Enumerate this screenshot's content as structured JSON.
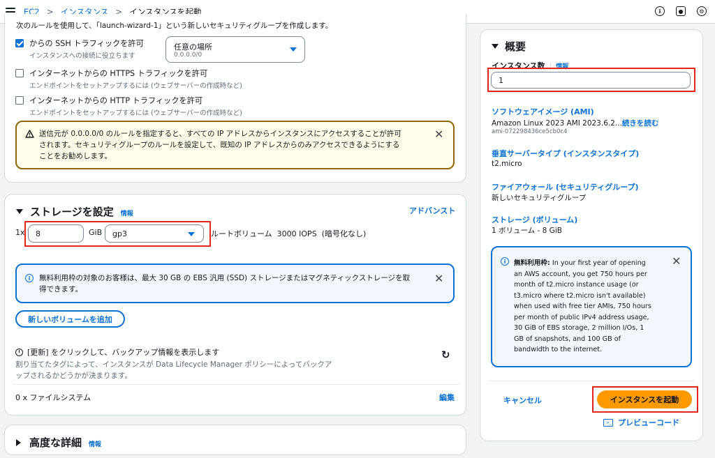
{
  "breadcrumb": {
    "ec2": "EC2",
    "instances": "インスタンス",
    "current": "インスタンスを起動"
  },
  "header_icons": [
    "info-icon",
    "notifications-icon",
    "settings-icon"
  ],
  "network": {
    "top_text": "次のルールを使用して、「launch-wizard-1」という新しいセキュリティグループを作成します。",
    "ssh_label": "からの SSH トラフィックを許可",
    "ssh_sub": "インスタンスへの接続に役立ちます",
    "ssh_checked": true,
    "source_select_label": "任意の場所",
    "source_select_value": "0.0.0.0/0",
    "https_label": "インターネットからの HTTPS トラフィックを許可",
    "https_sub": "エンドポイントをセットアップするには (ウェブサーバーの作成時など)",
    "http_label": "インターネットからの HTTP トラフィックを許可",
    "http_sub": "エンドポイントをセットアップするには (ウェブサーバーの作成時など)",
    "warning_line1": "送信元が 0.0.0.0/0 のルールを指定すると、すべての IP アドレスからインスタンスにアクセスすることが許可",
    "warning_line2": "されます。セキュリティグループのルールを設定して、既知の IP アドレスからのみアクセスできるようにする",
    "warning_line3": "ことをお勧めします。"
  },
  "storage": {
    "title": "ストレージを設定",
    "info": "情報",
    "advanced": "アドバンスト",
    "count_prefix": "1x",
    "size_value": "8",
    "unit": "GiB",
    "volume_type": "gp3",
    "root_desc": "ルートボリューム  3000 IOPS  (暗号化なし)",
    "info_line1": "無料利用枠の対象のお客様は、最大 30 GB の EBS 汎用 (SSD) ストレージまたはマグネティックストレージを取",
    "info_line2": "得できます。",
    "add_volume": "新しいボリュームを追加",
    "backup_line1": "[更新] をクリックして、バックアップ情報を表示します",
    "backup_line2": "割り当てたタグによって、インスタンスが Data Lifecycle Manager ポリシーによってバックア",
    "backup_line3": "ップされるかどうかが決まります。",
    "filesystems": "0 x ファイルシステム",
    "edit": "編集"
  },
  "advanced": {
    "title": "高度な詳細",
    "info": "情報"
  },
  "summary": {
    "title": "概要",
    "instance_count_label": "インスタンス数",
    "info": "情報",
    "instance_count_value": "1",
    "ami_label": "ソフトウェアイメージ (AMI)",
    "ami_name": "Amazon Linux 2023 AMI 2023.6.2...",
    "read_more": "続きを読む",
    "ami_id": "ami-072298436ce5cb0c4",
    "instance_type_label": "垂直サーバータイプ (インスタンスタイプ)",
    "instance_type": "t2.micro",
    "firewall_label": "ファイアウォール (セキュリティグループ)",
    "firewall_value": "新しいセキュリティグループ",
    "storage_label": "ストレージ (ボリューム)",
    "storage_value": "1 ボリューム - 8 GiB",
    "free_tier_title": "無料利用枠:",
    "free_tier_lines": [
      " In your first year of opening",
      "an AWS account, you get 750 hours per",
      "month of t2.micro instance usage (or",
      "t3.micro where t2.micro isn't available)",
      "when used with free tier AMIs, 750 hours",
      "per month of public IPv4 address usage,",
      "30 GiB of EBS storage, 2 million I/Os, 1",
      "GB of snapshots, and 100 GB of",
      "bandwidth to the internet."
    ],
    "cancel": "キャンセル",
    "launch": "インスタンスを起動",
    "preview": "プレビューコード"
  }
}
